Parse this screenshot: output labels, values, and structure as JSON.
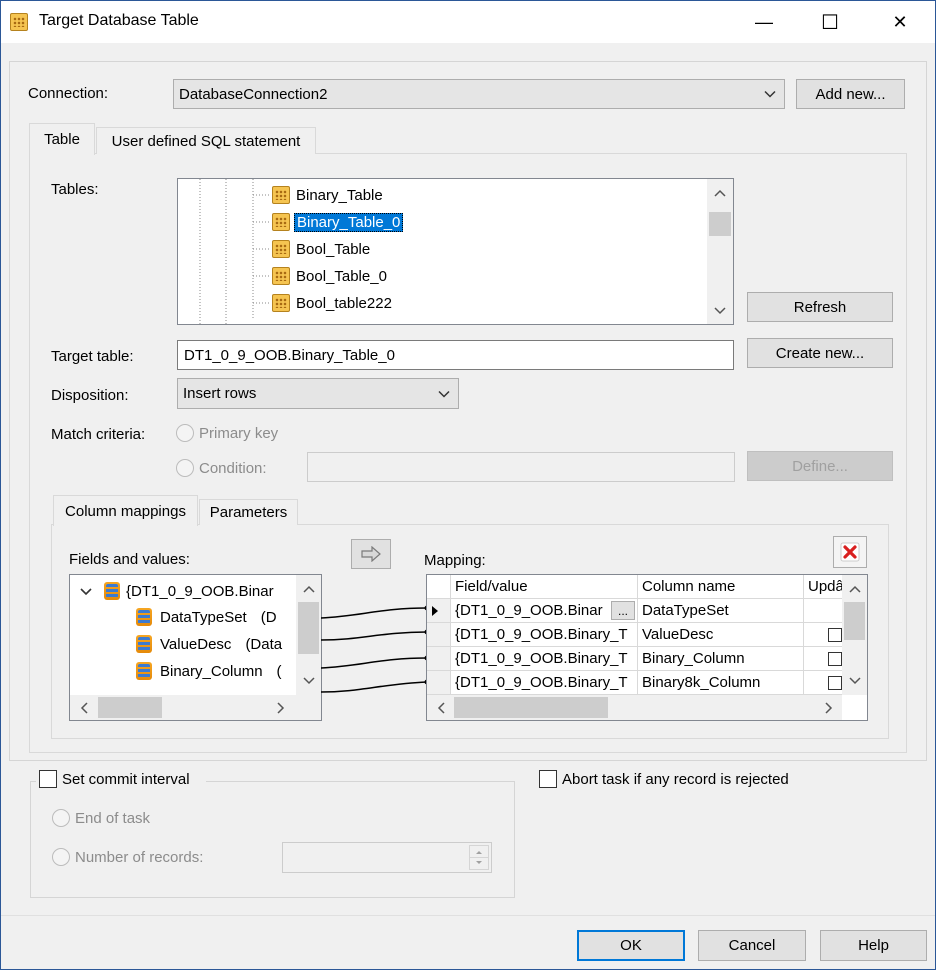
{
  "window": {
    "title": "Target Database Table",
    "controls": {
      "minimize": "—",
      "maximize": "☐",
      "close": "✕"
    }
  },
  "connection": {
    "label": "Connection:",
    "value": "DatabaseConnection2",
    "add_new": "Add new..."
  },
  "tabs": [
    {
      "label": "Table"
    },
    {
      "label": "User defined SQL statement"
    }
  ],
  "tables": {
    "label": "Tables:",
    "items": [
      "Binary_Table",
      "Binary_Table_0",
      "Bool_Table",
      "Bool_Table_0",
      "Bool_table222"
    ],
    "selected_index": 1,
    "refresh": "Refresh"
  },
  "target_table": {
    "label": "Target table:",
    "value": "DT1_0_9_OOB.Binary_Table_0",
    "create_new": "Create new..."
  },
  "disposition": {
    "label": "Disposition:",
    "value": "Insert rows"
  },
  "match": {
    "label": "Match criteria:",
    "primary_key": "Primary key",
    "condition": "Condition:",
    "define": "Define..."
  },
  "inner_tabs": [
    {
      "label": "Column mappings"
    },
    {
      "label": "Parameters"
    }
  ],
  "fields": {
    "label": "Fields and values:",
    "root": "{DT1_0_9_OOB.Binar",
    "items": [
      {
        "name": "DataTypeSet",
        "type": "(D"
      },
      {
        "name": "ValueDesc",
        "type": "(Data"
      },
      {
        "name": "Binary_Column",
        "type": "("
      }
    ]
  },
  "mapping": {
    "label": "Mapping:",
    "headers": [
      "Field/value",
      "Column name",
      "Updâ"
    ],
    "rows": [
      {
        "field": "{DT1_0_9_OOB.Binar",
        "column": "DataTypeSet"
      },
      {
        "field": "{DT1_0_9_OOB.Binary_T",
        "column": "ValueDesc"
      },
      {
        "field": "{DT1_0_9_OOB.Binary_T",
        "column": "Binary_Column"
      },
      {
        "field": "{DT1_0_9_OOB.Binary_T",
        "column": "Binary8k_Column"
      }
    ],
    "ellipsis": "..."
  },
  "commit": {
    "label": "Set commit interval",
    "end_of_task": "End of task",
    "number_of_records": "Number of records:"
  },
  "abort": {
    "label": "Abort task if any record is rejected"
  },
  "footer": {
    "ok": "OK",
    "cancel": "Cancel",
    "help": "Help"
  }
}
